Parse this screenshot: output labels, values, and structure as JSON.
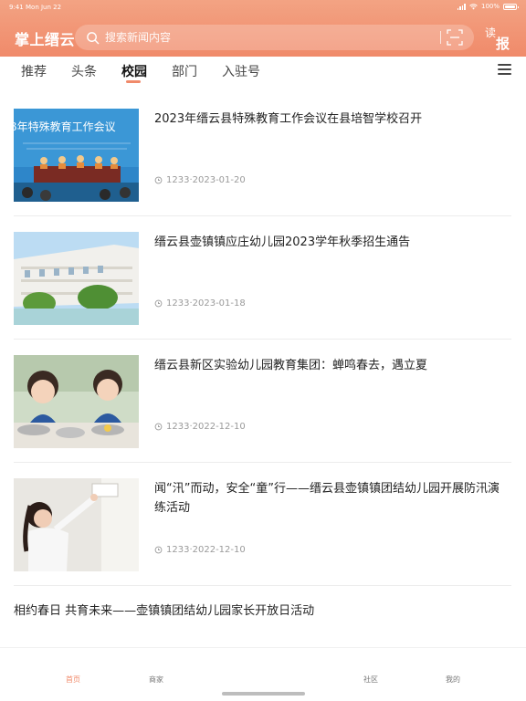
{
  "status_bar": {
    "time": "9:41",
    "date": "Mon Jun 22",
    "battery": "100%",
    "battery_level": 1.0
  },
  "header": {
    "app_title": "掌上缙云",
    "search_placeholder": "搜索新闻内容",
    "read_paper_char1": "读",
    "read_paper_char2": "报"
  },
  "tabs": [
    {
      "label": "推荐",
      "active": false
    },
    {
      "label": "头条",
      "active": false
    },
    {
      "label": "校园",
      "active": true
    },
    {
      "label": "部门",
      "active": false
    },
    {
      "label": "入驻号",
      "active": false
    }
  ],
  "news": [
    {
      "title": "2023年缙云县特殊教育工作会议在县培智学校召开",
      "meta": "1233·2023-01-20",
      "banner_text": "3年特殊教育工作会议"
    },
    {
      "title": "缙云县壶镇镇应庄幼儿园2023学年秋季招生通告",
      "meta": "1233·2023-01-18"
    },
    {
      "title": "缙云县新区实验幼儿园教育集团：蝉鸣春去，遇立夏",
      "meta": "1233·2022-12-10"
    },
    {
      "title": "闻“汛”而动，安全“童”行——缙云县壶镇镇团结幼儿园开展防汛演练活动",
      "meta": "1233·2022-12-10"
    },
    {
      "title": "相约春日 共育未来——壶镇镇团结幼儿园家长开放日活动"
    }
  ],
  "bottom_nav": [
    {
      "label": "首页",
      "active": true
    },
    {
      "label": "商家",
      "active": false
    },
    {
      "label": "社区",
      "active": false
    },
    {
      "label": "我的",
      "active": false
    }
  ],
  "colors": {
    "accent": "#f08a6a",
    "header_top": "#f3a383"
  }
}
